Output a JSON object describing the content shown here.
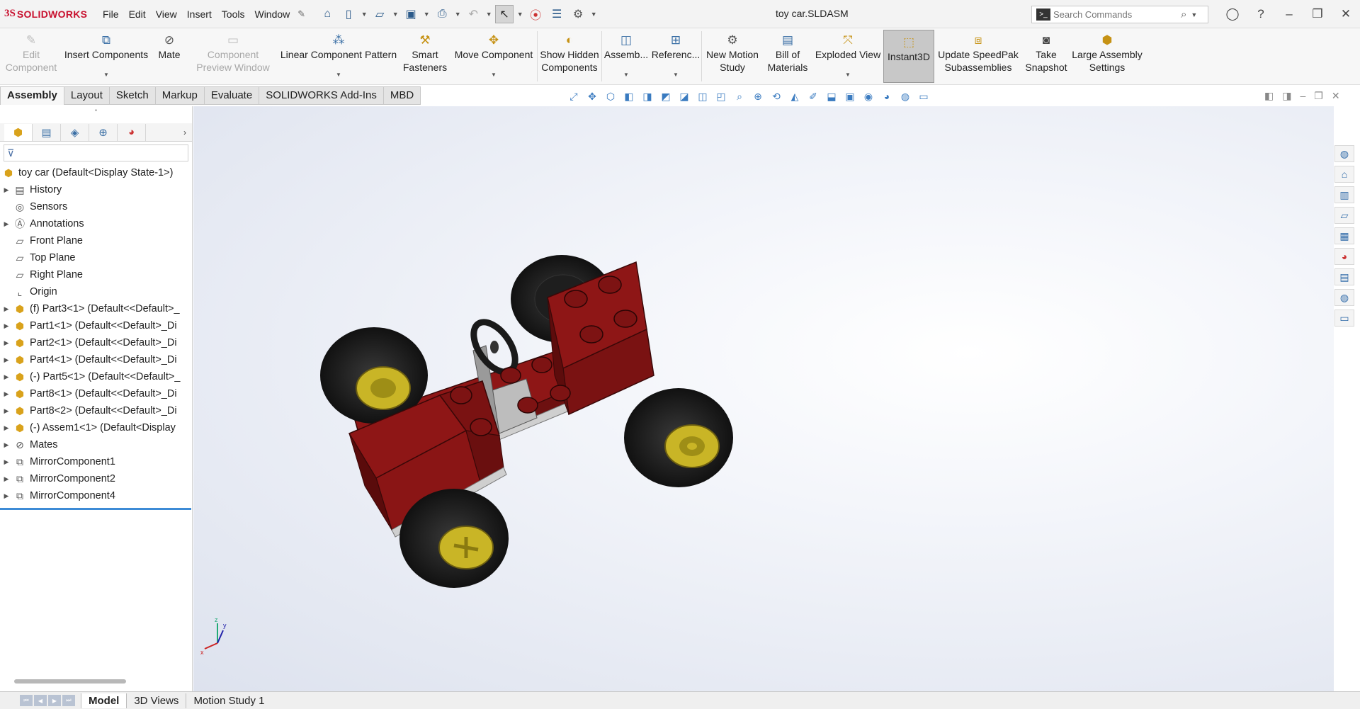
{
  "app": {
    "brand_ds": "3S",
    "brand_name": "SOLIDWORKS",
    "document_title": "toy car.SLDASM"
  },
  "menu": [
    "File",
    "Edit",
    "View",
    "Insert",
    "Tools",
    "Window"
  ],
  "search": {
    "placeholder": "Search Commands"
  },
  "ribbon": {
    "edit_component": "Edit Component",
    "insert_components": "Insert Components",
    "mate": "Mate",
    "component_preview": "Component Preview Window",
    "linear_pattern": "Linear Component Pattern",
    "smart_fasteners": "Smart Fasteners",
    "move_component": "Move Component",
    "show_hidden": "Show Hidden Components",
    "assembly": "Assemb...",
    "reference": "Referenc...",
    "new_motion": "New Motion Study",
    "bom": "Bill of Materials",
    "exploded": "Exploded View",
    "instant3d": "Instant3D",
    "speedpak": "Update SpeedPak Subassemblies",
    "snapshot": "Take Snapshot",
    "large_assembly": "Large Assembly Settings"
  },
  "command_tabs": [
    "Assembly",
    "Layout",
    "Sketch",
    "Markup",
    "Evaluate",
    "SOLIDWORKS Add-Ins",
    "MBD"
  ],
  "tree": {
    "root": "toy car  (Default<Display State-1>)",
    "items": [
      {
        "label": "History",
        "expand": true,
        "icon": "folder"
      },
      {
        "label": "Sensors",
        "expand": false,
        "icon": "sensor"
      },
      {
        "label": "Annotations",
        "expand": true,
        "icon": "annotation"
      },
      {
        "label": "Front Plane",
        "expand": false,
        "icon": "plane"
      },
      {
        "label": "Top Plane",
        "expand": false,
        "icon": "plane"
      },
      {
        "label": "Right Plane",
        "expand": false,
        "icon": "plane"
      },
      {
        "label": "Origin",
        "expand": false,
        "icon": "origin"
      },
      {
        "label": "(f) Part3<1> (Default<<Default>_",
        "expand": true,
        "icon": "part"
      },
      {
        "label": "Part1<1> (Default<<Default>_Di",
        "expand": true,
        "icon": "part"
      },
      {
        "label": "Part2<1> (Default<<Default>_Di",
        "expand": true,
        "icon": "part"
      },
      {
        "label": "Part4<1> (Default<<Default>_Di",
        "expand": true,
        "icon": "part"
      },
      {
        "label": "(-) Part5<1> (Default<<Default>_",
        "expand": true,
        "icon": "part"
      },
      {
        "label": "Part8<1> (Default<<Default>_Di",
        "expand": true,
        "icon": "part"
      },
      {
        "label": "Part8<2> (Default<<Default>_Di",
        "expand": true,
        "icon": "part"
      },
      {
        "label": "(-) Assem1<1> (Default<Display",
        "expand": true,
        "icon": "assembly"
      },
      {
        "label": "Mates",
        "expand": true,
        "icon": "mates"
      },
      {
        "label": "MirrorComponent1",
        "expand": true,
        "icon": "mirror"
      },
      {
        "label": "MirrorComponent2",
        "expand": true,
        "icon": "mirror"
      },
      {
        "label": "MirrorComponent4",
        "expand": true,
        "icon": "mirror"
      }
    ]
  },
  "triad": {
    "x": "x",
    "y": "y",
    "z": "z"
  },
  "bottom_tabs": [
    "Model",
    "3D Views",
    "Motion Study 1"
  ],
  "colors": {
    "body_red": "#8e1616",
    "accent_blue": "#3d8bd6",
    "hub_yellow": "#c9b526",
    "brand_red": "#c8102e"
  }
}
